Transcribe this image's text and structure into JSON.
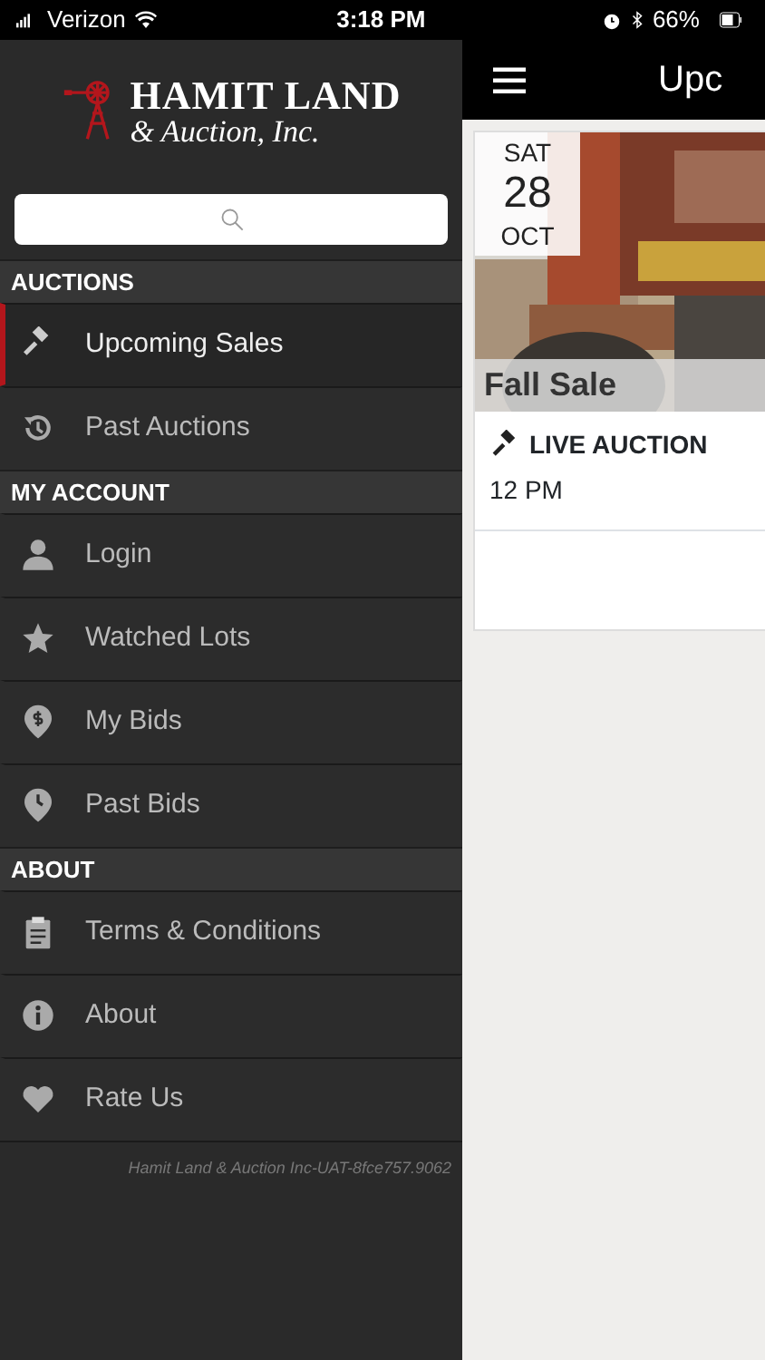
{
  "status_bar": {
    "carrier": "Verizon",
    "time": "3:18 PM",
    "battery": "66%"
  },
  "sidebar": {
    "logo": {
      "title": "HAMIT LAND",
      "subtitle": "& Auction, Inc."
    },
    "sections": [
      {
        "title": "AUCTIONS",
        "items": [
          {
            "label": "Upcoming Sales",
            "selected": true
          },
          {
            "label": "Past Auctions",
            "selected": false
          }
        ]
      },
      {
        "title": "MY ACCOUNT",
        "items": [
          {
            "label": "Login",
            "selected": false
          },
          {
            "label": "Watched Lots",
            "selected": false
          },
          {
            "label": "My Bids",
            "selected": false
          },
          {
            "label": "Past Bids",
            "selected": false
          }
        ]
      },
      {
        "title": "ABOUT",
        "items": [
          {
            "label": "Terms & Conditions",
            "selected": false
          },
          {
            "label": "About",
            "selected": false
          },
          {
            "label": "Rate Us",
            "selected": false
          }
        ]
      }
    ],
    "version": "Hamit Land & Auction Inc-UAT-8fce757.9062"
  },
  "header": {
    "title": "Upc"
  },
  "sales": [
    {
      "weekday": "SAT",
      "day": "28",
      "month": "OCT",
      "title": "Fall Sale",
      "type": "LIVE AUCTION",
      "time": "12 PM"
    }
  ]
}
